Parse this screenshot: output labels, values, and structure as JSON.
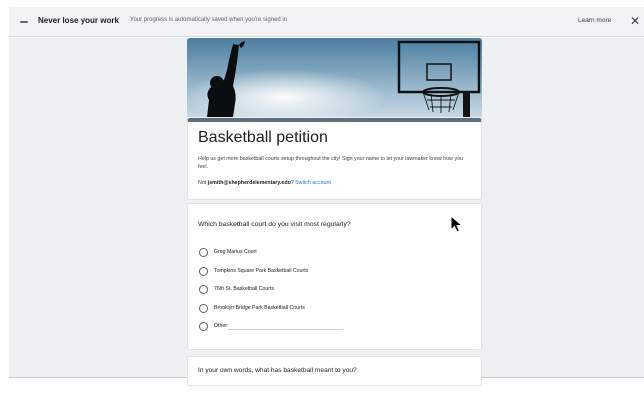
{
  "banner": {
    "title": "Never lose your work",
    "text": "Your progress is automatically saved when you're signed in",
    "learn_more": "Learn more",
    "close": "✕"
  },
  "form": {
    "title": "Basketball petition",
    "description": "Help us get more basketball courts setup throughout the city! Sign your name to let your lawmaker know how you feel.",
    "account_prefix": "Not",
    "account_email": "jsmith@shepherdelementary.edu",
    "account_suffix": "?",
    "switch_account": "Switch account"
  },
  "question1": {
    "title": "Which basketball court do you visit most regularly?",
    "options": [
      "Greg Marius Court",
      "Tompkins Square Park Basketball Courts",
      "76th St. Basketball Courts",
      "Brooklyn Bridge Park Basketball Courts",
      "Other:"
    ]
  },
  "question2": {
    "title": "In your own words, what has basketball meant to you?"
  },
  "colors": {
    "accent": "#5e6f7c",
    "link": "#1a73e8",
    "background": "#eef0f1"
  },
  "icons": {
    "banner": "minus-icon",
    "close": "close-icon",
    "cursor": "mouse-pointer-icon",
    "option": "radio-button-icon"
  }
}
